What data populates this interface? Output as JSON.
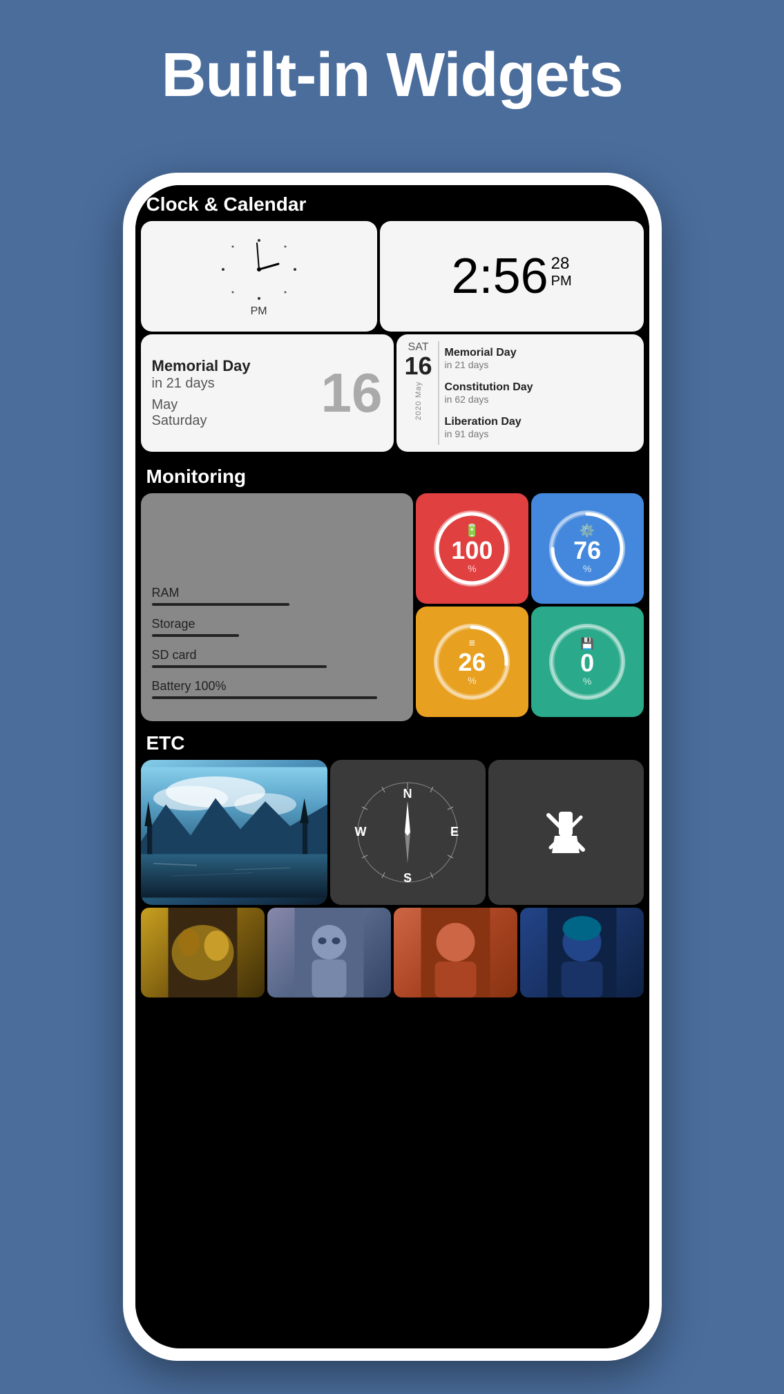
{
  "header": {
    "title": "Built-in Widgets",
    "background_color": "#4a6d9c"
  },
  "phone": {
    "screen": {
      "sections": {
        "clock_calendar": {
          "label": "Clock & Calendar",
          "analog_clock": {
            "time": "2:56 PM",
            "am_pm": "PM"
          },
          "digital_clock": {
            "hours_minutes": "2:56",
            "seconds": "28",
            "am_pm": "PM"
          },
          "calendar_left": {
            "event_name": "Memorial Day",
            "days_until": "in 21 days",
            "month": "May",
            "day_name": "Saturday",
            "day_number": "16"
          },
          "calendar_right": {
            "day_abbr": "SAT",
            "day_number": "16",
            "year_month": "2020 May",
            "events": [
              {
                "name": "Memorial Day",
                "days": "in 21 days"
              },
              {
                "name": "Constitution Day",
                "days": "in 62 days"
              },
              {
                "name": "Liberation Day",
                "days": "in 91 days"
              }
            ]
          }
        },
        "monitoring": {
          "label": "Monitoring",
          "items": [
            {
              "label": "RAM",
              "bar_width": "55"
            },
            {
              "label": "Storage",
              "bar_width": "35"
            },
            {
              "label": "SD card",
              "bar_width": "70"
            },
            {
              "label": "Battery 100%",
              "bar_width": "90"
            }
          ],
          "tiles": [
            {
              "id": "battery",
              "value": "100",
              "unit": "%",
              "icon": "battery",
              "color": "#e04040"
            },
            {
              "id": "cpu",
              "value": "76",
              "unit": "%",
              "icon": "cpu",
              "color": "#4488dd"
            },
            {
              "id": "ram",
              "value": "26",
              "unit": "%",
              "icon": "ram",
              "color": "#e8a020"
            },
            {
              "id": "sdcard",
              "value": "0",
              "unit": "%",
              "icon": "sdcard",
              "color": "#2aaa8a"
            }
          ]
        },
        "etc": {
          "label": "ETC",
          "compass": {
            "north": "N",
            "south": "S",
            "east": "E",
            "west": "W"
          },
          "flashlight": {
            "label": "Flashlight"
          },
          "photos": [
            {
              "id": "photo1",
              "desc": "autumn leaves"
            },
            {
              "id": "photo2",
              "desc": "person portrait"
            },
            {
              "id": "photo3",
              "desc": "person portrait orange"
            },
            {
              "id": "photo4",
              "desc": "person portrait dark"
            }
          ]
        }
      }
    }
  }
}
